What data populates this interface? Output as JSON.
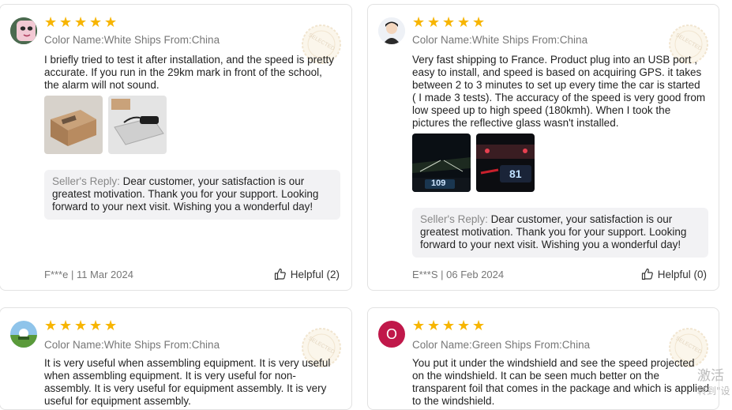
{
  "stamp_text": "SELECTED",
  "reviews": [
    {
      "stars": [
        "★",
        "★",
        "★",
        "★",
        "★"
      ],
      "meta": "Color Name:White Ships From:China",
      "text": "I briefly tried to test it after installation, and the speed is pretty accurate. If you run in the 29km mark in front of the school, the alarm will not sound.",
      "reply_label": "Seller's Reply:",
      "reply_text": "Dear customer, your satisfaction is our greatest motivation. Thank you for your support. Looking forward to your next visit. Wishing you a wonderful day!",
      "author_date": "F***e | 11 Mar 2024",
      "helpful": "Helpful (2)"
    },
    {
      "stars": [
        "★",
        "★",
        "★",
        "★",
        "★"
      ],
      "meta": "Color Name:White Ships From:China",
      "text": "Very fast shipping to France. Product plug into an USB port , easy to install, and speed is based on acquiring GPS. it takes between 2 to 3 minutes to set up every time the car is started ( I made 3 tests). The accuracy of the speed is very good from low speed up to high speed (180kmh). When I took the pictures the reflective glass wasn't installed.",
      "photo_labels": [
        "109",
        "81"
      ],
      "reply_label": "Seller's Reply:",
      "reply_text": "Dear customer, your satisfaction is our greatest motivation. Thank you for your support. Looking forward to your next visit. Wishing you a wonderful day!",
      "author_date": "E***S | 06 Feb 2024",
      "helpful": "Helpful (0)"
    },
    {
      "stars": [
        "★",
        "★",
        "★",
        "★",
        "★"
      ],
      "meta": "Color Name:White Ships From:China",
      "text": "It is very useful when assembling equipment. It is very useful when assembling equipment. It is very useful for non-assembly. It is very useful for equipment assembly. It is very useful for equipment assembly."
    },
    {
      "avatar_letter": "O",
      "stars": [
        "★",
        "★",
        "★",
        "★",
        "★"
      ],
      "meta": "Color Name:Green Ships From:China",
      "text": "You put it under the windshield and see the speed projected on the windshield. It can be seen much better on the transparent foil that comes in the package and which is applied to the windshield."
    }
  ],
  "watermark": {
    "line1": "激活",
    "line2": "转到\"设"
  }
}
